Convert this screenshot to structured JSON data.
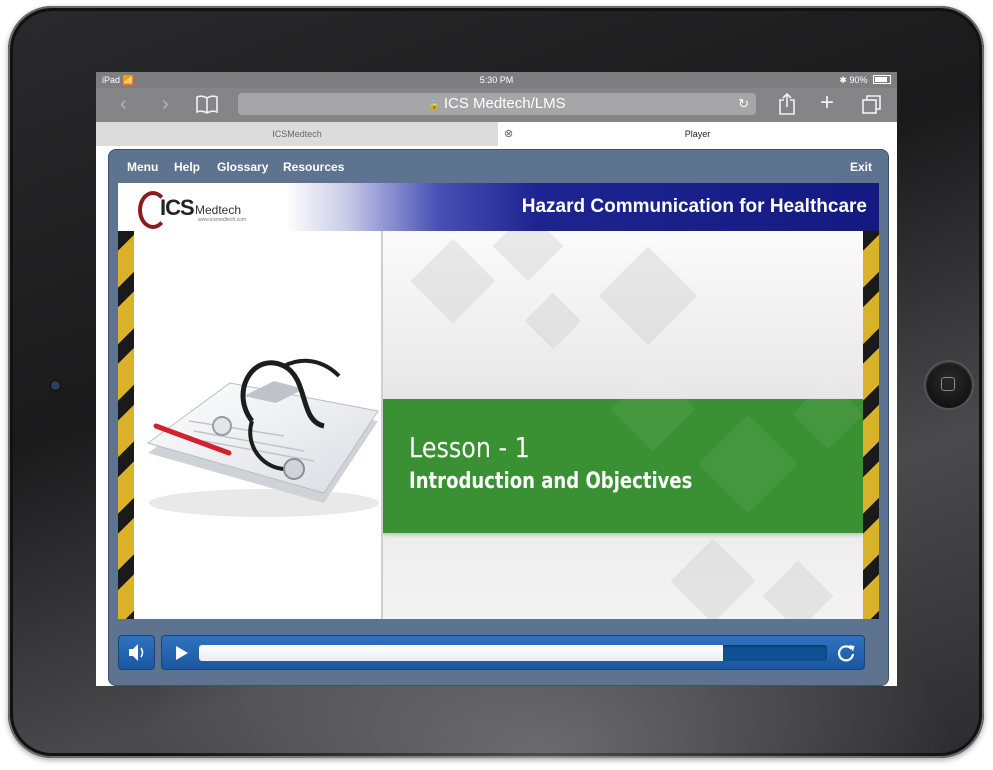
{
  "status_bar": {
    "device": "iPad",
    "time": "5:30 PM",
    "battery": "90%"
  },
  "browser": {
    "url": "ICS Medtech/LMS",
    "tabs": [
      {
        "label": "ICSMedtech"
      },
      {
        "label": "Player"
      }
    ]
  },
  "player": {
    "menu": {
      "menu_label": "Menu",
      "help_label": "Help",
      "glossary_label": "Glossary",
      "resources_label": "Resources",
      "exit_label": "Exit"
    },
    "slide": {
      "logo_text": "ICS Medtech",
      "logo_url": "www.icsmedtech.com",
      "course_title": "Hazard Communication for Healthcare",
      "lesson_number": "Lesson - 1",
      "lesson_title": "Introduction and Objectives"
    },
    "progress": 0.835,
    "colors": {
      "player_frame": "#5e7390",
      "header_blue": "#141a82",
      "lesson_green": "#3a9133",
      "control_blue": "#2f73c0"
    }
  }
}
